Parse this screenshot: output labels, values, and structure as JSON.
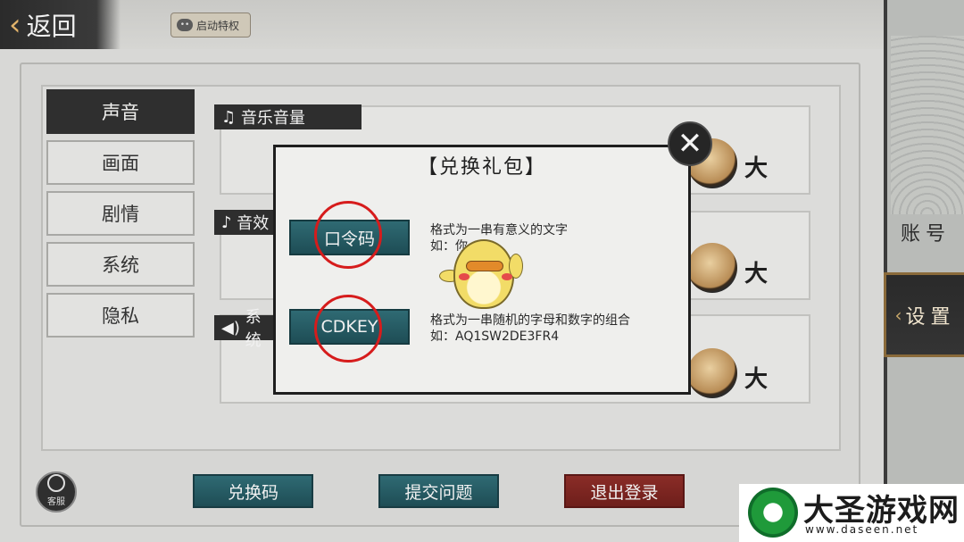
{
  "topbar": {
    "back_label": "返回",
    "wechat_label": "启动特权"
  },
  "right_tabs": {
    "account": "账号",
    "settings": "设置"
  },
  "side_tabs": [
    {
      "label": "声音",
      "active": true
    },
    {
      "label": "画面",
      "active": false
    },
    {
      "label": "剧情",
      "active": false
    },
    {
      "label": "系统",
      "active": false
    },
    {
      "label": "隐私",
      "active": false
    }
  ],
  "sections": [
    {
      "label": "音乐音量",
      "icon": "music-note-icon"
    },
    {
      "label": "音效",
      "icon": "music-note-icon"
    },
    {
      "label": "系统",
      "icon": "speaker-icon"
    }
  ],
  "slider_max_label": "大",
  "bottom_buttons": {
    "redeem": "兑换码",
    "feedback": "提交问题",
    "logout": "退出登录"
  },
  "customer_service_label": "客服",
  "modal": {
    "title": "【兑换礼包】",
    "password_button": "口令码",
    "password_desc": "格式为一串有意义的文字",
    "password_example": "如：你",
    "cdkey_button": "CDKEY",
    "cdkey_desc": "格式为一串随机的字母和数字的组合",
    "cdkey_example": "如：AQ1SW2DE3FR4"
  },
  "watermark": {
    "title": "大圣游戏网",
    "url": "www.daseen.net"
  },
  "colors": {
    "teal_button": "#2f6a73",
    "red_button": "#8a2c27",
    "annotation_red": "#d61c1c"
  }
}
